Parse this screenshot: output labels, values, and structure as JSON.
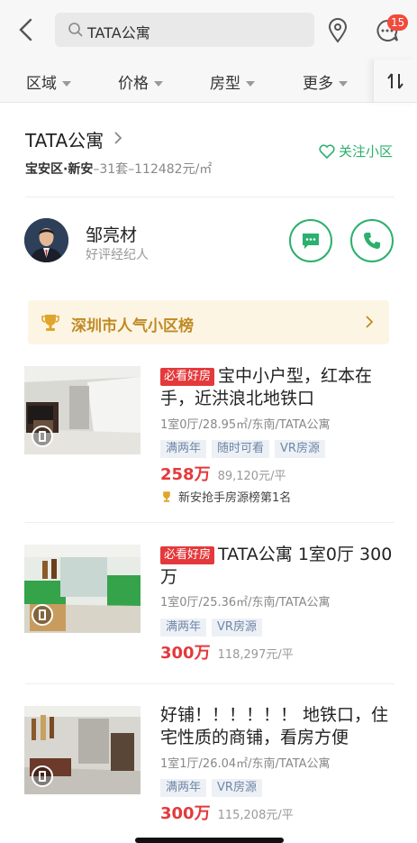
{
  "search": {
    "query": "TATA公寓"
  },
  "header": {
    "badge_count": "15"
  },
  "filters": [
    "区域",
    "价格",
    "房型",
    "更多"
  ],
  "community": {
    "name": "TATA公寓",
    "district": "宝安区·新安",
    "stats": "–31套–112482元/㎡",
    "follow_label": "关注小区"
  },
  "agent": {
    "name": "邹亮材",
    "role": "好评经纪人"
  },
  "ranking_banner": {
    "label": "深圳市人气小区榜"
  },
  "listings": [
    {
      "badge": "必看好房",
      "title": "宝中小户型，红本在手，近洪浪北地铁口",
      "info": "1室0厅/28.95㎡/东南/TATA公寓",
      "tags": [
        "满两年",
        "随时可看",
        "VR房源"
      ],
      "price": "258万",
      "unit_price": "89,120元/平",
      "award": "新安抢手房源榜第1名"
    },
    {
      "badge": "必看好房",
      "title": "TATA公寓 1室0厅 300万",
      "info": "1室0厅/25.36㎡/东南/TATA公寓",
      "tags": [
        "满两年",
        "VR房源"
      ],
      "price": "300万",
      "unit_price": "118,297元/平"
    },
    {
      "title": "好铺！！！！！！ 地铁口，住宅性质的商铺，看房方便",
      "info": "1室1厅/26.04㎡/东南/TATA公寓",
      "tags": [
        "满两年",
        "VR房源"
      ],
      "price": "300万",
      "unit_price": "115,208元/平"
    }
  ],
  "colors": {
    "accent_green": "#2bb06d",
    "price_red": "#e4393c",
    "gold": "#c08a23"
  }
}
